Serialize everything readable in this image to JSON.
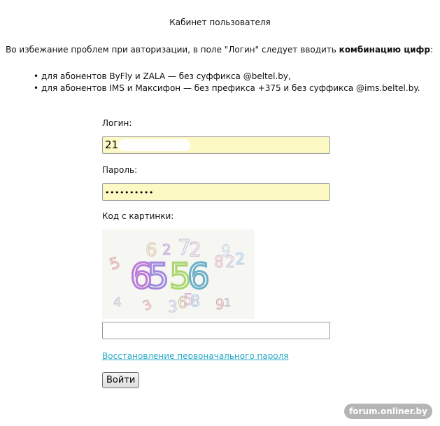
{
  "page": {
    "title": "Кабинет пользователя",
    "intro_before": "Во избежание проблем при авторизации, в поле \"Логин\" следует вводить ",
    "intro_bold": "комбинацию цифр",
    "intro_after": ":",
    "notes": [
      "для абонентов ByFly и ZALA — без суффикса @beltel.by,",
      "для абонентов IMS и Максифон — без префикса +375 и без суффикса @ims.beltel.by."
    ]
  },
  "form": {
    "login_label": "Логин:",
    "login_value": "21",
    "password_label": "Пароль:",
    "password_value": "••••••••••",
    "captcha_label": "Код с картинки:",
    "captcha_value": "",
    "captcha_text": "6556",
    "recover_link": "Восстановление первоначального пароля",
    "submit_label": "Войти"
  },
  "watermark": "forum.onliner.by"
}
